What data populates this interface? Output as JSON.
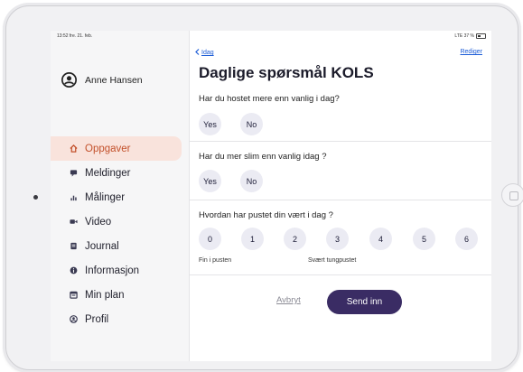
{
  "status_bar": {
    "time_date": "13:52 fre. 21. feb.",
    "signal": "LTE 37 %"
  },
  "user": {
    "name": "Anne Hansen"
  },
  "sidebar": {
    "items": [
      {
        "label": "Oppgaver",
        "icon": "home-icon",
        "active": true
      },
      {
        "label": "Meldinger",
        "icon": "chat-icon",
        "active": false
      },
      {
        "label": "Målinger",
        "icon": "bar-chart-icon",
        "active": false
      },
      {
        "label": "Video",
        "icon": "video-icon",
        "active": false
      },
      {
        "label": "Journal",
        "icon": "journal-icon",
        "active": false
      },
      {
        "label": "Informasjon",
        "icon": "info-icon",
        "active": false
      },
      {
        "label": "Min plan",
        "icon": "plan-icon",
        "active": false
      },
      {
        "label": "Profil",
        "icon": "person-icon",
        "active": false
      }
    ]
  },
  "header": {
    "back_label": "Idag",
    "edit_label": "Rediger",
    "title": "Daglige spørsmål KOLS"
  },
  "questions": [
    {
      "text": "Har du hostet mere enn vanlig i dag?",
      "options": [
        "Yes",
        "No"
      ]
    },
    {
      "text": "Har du mer slim enn vanlig idag ?",
      "options": [
        "Yes",
        "No"
      ]
    },
    {
      "text": "Hvordan har pustet din vært i dag ?",
      "options": [
        "0",
        "1",
        "2",
        "3",
        "4",
        "5",
        "6"
      ],
      "scale_min_label": "Fin i pusten",
      "scale_max_label": "Svært tungpustet"
    }
  ],
  "actions": {
    "cancel_label": "Avbryt",
    "submit_label": "Send inn"
  },
  "colors": {
    "active_nav_text": "#c3512b",
    "active_nav_bg": "#f9e3dc",
    "primary_button": "#3a2c64",
    "link": "#1a5bd6",
    "option_bg": "#ebebf3"
  }
}
